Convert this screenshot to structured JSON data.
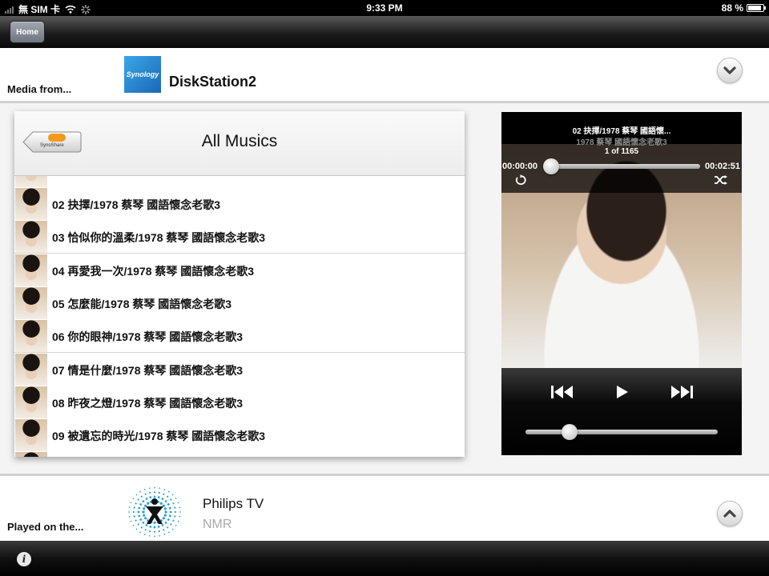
{
  "status_bar": {
    "carrier": "無 SIM 卡",
    "time": "9:33 PM",
    "battery": "88 %",
    "battery_level": 0.88
  },
  "nav": {
    "home_label": "Home"
  },
  "source": {
    "label": "Media from...",
    "logo_text": "Synology",
    "name": "DiskStation2"
  },
  "list": {
    "back_label": "SynoShare",
    "title": "All Musics",
    "items": [
      {
        "title": "02 抉擇/1978 蔡琴 國語懷念老歌3"
      },
      {
        "title": "03 恰似你的溫柔/1978 蔡琴 國語懷念老歌3"
      },
      {
        "title": "04 再愛我一次/1978 蔡琴 國語懷念老歌3"
      },
      {
        "title": "05 怎麼能/1978 蔡琴 國語懷念老歌3"
      },
      {
        "title": "06 你的眼神/1978 蔡琴 國語懷念老歌3"
      },
      {
        "title": "07 情是什麼/1978 蔡琴 國語懷念老歌3"
      },
      {
        "title": "08 昨夜之燈/1978 蔡琴 國語懷念老歌3"
      },
      {
        "title": "09 被遺忘的時光/1978 蔡琴 國語懷念老歌3"
      }
    ]
  },
  "player": {
    "now_title": "02 抉擇/1978 蔡琴 國語懷...",
    "now_subtitle": "1978 蔡琴 國語懷念老歌3",
    "position": "1 of 1165",
    "elapsed": "00:00:00",
    "duration": "00:02:51",
    "progress": 0.0,
    "volume": 0.23
  },
  "target": {
    "label": "Played on the...",
    "name": "Philips TV",
    "subtitle": "NMR"
  },
  "icons": {
    "accent": "#2b9fd6"
  }
}
